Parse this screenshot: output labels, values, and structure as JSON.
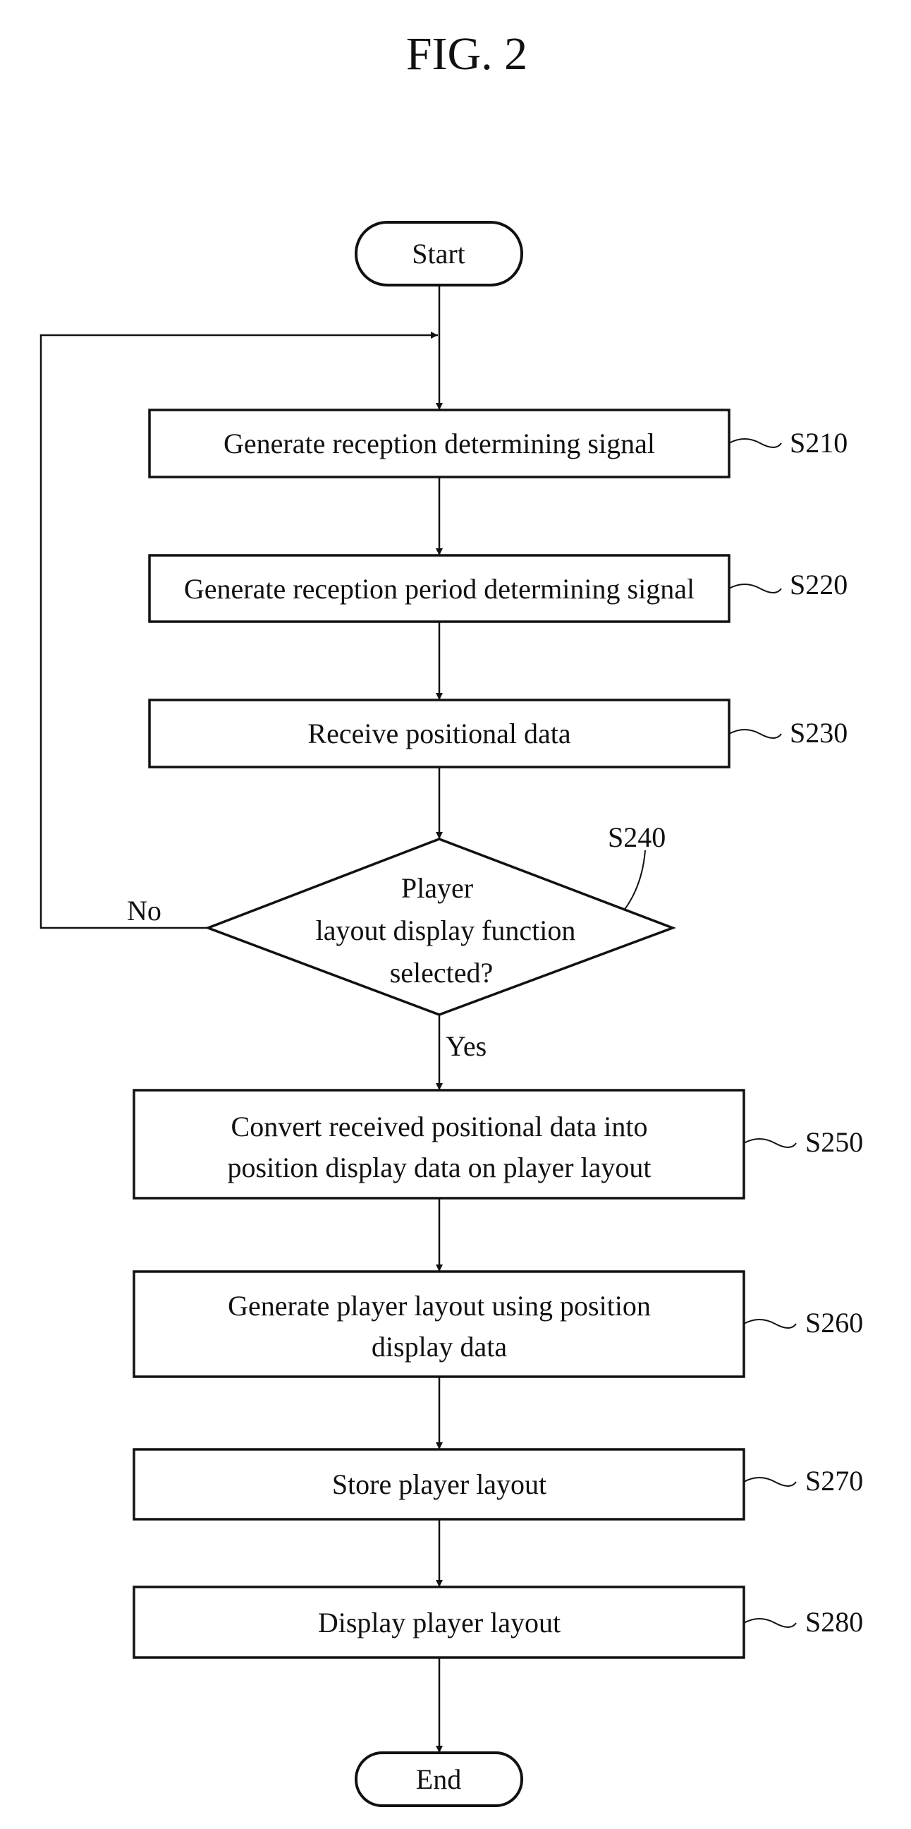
{
  "figure": {
    "title": "FIG. 2"
  },
  "terminals": {
    "start": "Start",
    "end": "End"
  },
  "steps": [
    {
      "id": "S210",
      "lines": [
        "Generate reception determining signal"
      ]
    },
    {
      "id": "S220",
      "lines": [
        "Generate reception period determining signal"
      ]
    },
    {
      "id": "S230",
      "lines": [
        "Receive positional data"
      ]
    },
    {
      "id": "S250",
      "lines": [
        "Convert received positional data into",
        "position display data on player layout"
      ]
    },
    {
      "id": "S260",
      "lines": [
        "Generate player layout using position",
        "display data"
      ]
    },
    {
      "id": "S270",
      "lines": [
        "Store player layout"
      ]
    },
    {
      "id": "S280",
      "lines": [
        "Display player layout"
      ]
    }
  ],
  "decision": {
    "id": "S240",
    "lines": [
      "Player",
      "layout display function",
      "selected?"
    ],
    "yes_label": "Yes",
    "no_label": "No"
  },
  "colors": {
    "ink": "#111111",
    "background": "#ffffff"
  }
}
